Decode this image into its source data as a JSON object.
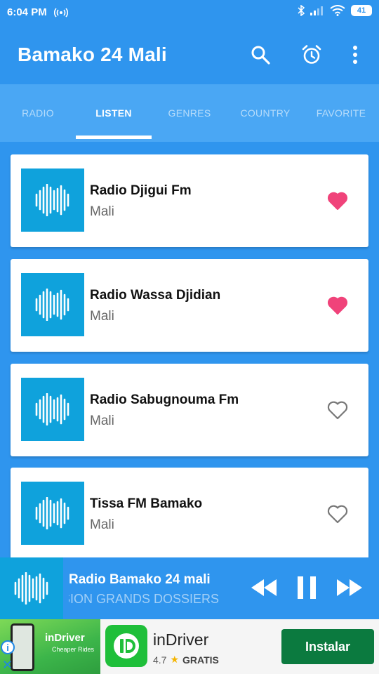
{
  "status_bar": {
    "time": "6:04 PM",
    "battery": "41",
    "icons": [
      "hotspot-icon",
      "bluetooth-icon",
      "signal-icon",
      "wifi-icon",
      "battery-icon"
    ]
  },
  "app_bar": {
    "title": "Bamako 24 Mali",
    "actions": [
      "search-icon",
      "alarm-icon",
      "more-vert-icon"
    ]
  },
  "tabs": [
    {
      "label": "RADIO",
      "active": false
    },
    {
      "label": "LISTEN",
      "active": true
    },
    {
      "label": "GENRES",
      "active": false
    },
    {
      "label": "COUNTRY",
      "active": false
    },
    {
      "label": "FAVORITE",
      "active": false
    }
  ],
  "stations": [
    {
      "name": "Radio Djigui Fm",
      "country": "Mali",
      "favorite": true
    },
    {
      "name": "Radio Wassa Djidian",
      "country": "Mali",
      "favorite": true
    },
    {
      "name": "Radio Sabugnouma Fm",
      "country": "Mali",
      "favorite": false
    },
    {
      "name": "Tissa FM Bamako",
      "country": "Mali",
      "favorite": false
    }
  ],
  "player": {
    "title": "Radio Bamako 24 mali",
    "now_playing": "SSION GRANDS DOSSIERS",
    "controls": [
      "rewind-icon",
      "pause-icon",
      "fast-forward-icon"
    ]
  },
  "ad": {
    "image_brand": "inDriver",
    "image_tagline": "Cheaper Rides",
    "app_name": "inDriver",
    "rating": "4.7",
    "price": "GRATIS",
    "install_label": "Instalar"
  },
  "colors": {
    "primary": "#2f95ee",
    "tab_bar": "#4aa7f4",
    "thumb": "#0fa2dc",
    "favorite": "#f0437a",
    "install": "#0b7a3f"
  }
}
